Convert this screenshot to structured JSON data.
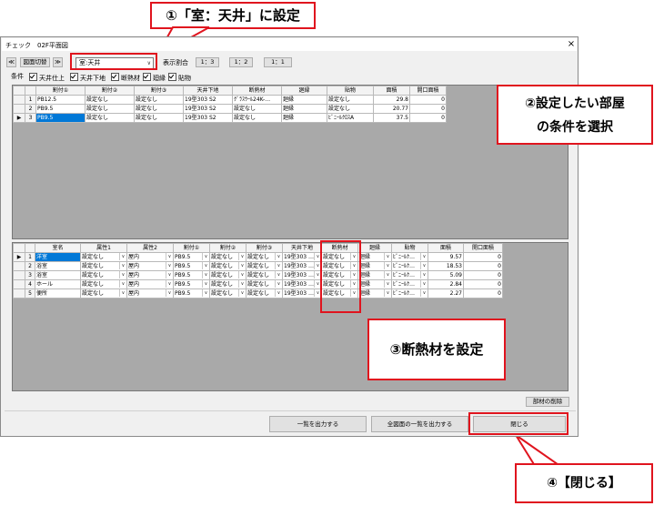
{
  "callouts": {
    "c1": "①「室：天井」に設定",
    "c2_line1": "②設定したい部屋",
    "c2_line2": "の条件を選択",
    "c3": "③断熱材を設定",
    "c4": "④【閉じる】"
  },
  "window": {
    "title": "チェック　02F平面図",
    "close": "×"
  },
  "toolbar": {
    "prev": "≪",
    "switch_label": "図面切替",
    "next": "≫",
    "combo_value": "室:天井",
    "ratio_label": "表示割合",
    "ratios": [
      "1：3",
      "1：2",
      "1：1"
    ]
  },
  "conditions": {
    "label": "条件",
    "items": [
      "天井仕上",
      "天井下地",
      "断熱材",
      "廻縁",
      "貼物"
    ]
  },
  "top_grid": {
    "headers": [
      "",
      "",
      "割付①",
      "割付②",
      "割付③",
      "天井下地",
      "断熱材",
      "廻縁",
      "貼物",
      "面積",
      "開口面積"
    ],
    "rows": [
      {
        "marker": "",
        "no": "1",
        "c1": "PB12.5",
        "c2": "設定なし",
        "c3": "設定なし",
        "c4": "19型303 S2",
        "c5": "ｸﾞﾗｽｳｰﾙ24K-…",
        "c6": "廻縁",
        "c7": "設定なし",
        "area": "29.8",
        "open": "0"
      },
      {
        "marker": "",
        "no": "2",
        "c1": "PB9.5",
        "c2": "設定なし",
        "c3": "設定なし",
        "c4": "19型303 S2",
        "c5": "設定なし",
        "c6": "廻縁",
        "c7": "設定なし",
        "area": "20.77",
        "open": "0"
      },
      {
        "marker": "▶",
        "no": "3",
        "c1": "PB9.5",
        "c2": "設定なし",
        "c3": "設定なし",
        "c4": "19型303 S2",
        "c5": "設定なし",
        "c6": "廻縁",
        "c7": "ﾋﾞﾆｰﾙｸﾛｽA",
        "area": "37.5",
        "open": "0"
      }
    ]
  },
  "bottom_grid": {
    "headers": [
      "",
      "",
      "室名",
      "属性1",
      "属性2",
      "割付①",
      "割付②",
      "割付③",
      "天井下地",
      "断熱材",
      "廻縁",
      "貼物",
      "面積",
      "開口面積"
    ],
    "rows": [
      {
        "marker": "▶",
        "no": "1",
        "name": "洋室",
        "a1": "設定なし",
        "a2": "屋内",
        "k1": "PB9.5",
        "k2": "設定なし",
        "k3": "設定なし",
        "base": "19型303 …",
        "ins": "設定なし",
        "mawa": "廻縁",
        "hari": "ﾋﾞﾆｰﾙｸ…",
        "area": "9.57",
        "open": "0"
      },
      {
        "marker": "",
        "no": "2",
        "name": "浴室",
        "a1": "設定なし",
        "a2": "屋内",
        "k1": "PB9.5",
        "k2": "設定なし",
        "k3": "設定なし",
        "base": "19型303 …",
        "ins": "設定なし",
        "mawa": "廻縁",
        "hari": "ﾋﾞﾆｰﾙｸ…",
        "area": "18.53",
        "open": "0"
      },
      {
        "marker": "",
        "no": "3",
        "name": "浴室",
        "a1": "設定なし",
        "a2": "屋内",
        "k1": "PB9.5",
        "k2": "設定なし",
        "k3": "設定なし",
        "base": "19型303 …",
        "ins": "設定なし",
        "mawa": "廻縁",
        "hari": "ﾋﾞﾆｰﾙｸ…",
        "area": "5.09",
        "open": "0"
      },
      {
        "marker": "",
        "no": "4",
        "name": "ホール",
        "a1": "設定なし",
        "a2": "屋内",
        "k1": "PB9.5",
        "k2": "設定なし",
        "k3": "設定なし",
        "base": "19型303 …",
        "ins": "設定なし",
        "mawa": "廻縁",
        "hari": "ﾋﾞﾆｰﾙｸ…",
        "area": "2.84",
        "open": "0"
      },
      {
        "marker": "",
        "no": "5",
        "name": "便所",
        "a1": "設定なし",
        "a2": "屋内",
        "k1": "PB9.5",
        "k2": "設定なし",
        "k3": "設定なし",
        "base": "19型303 …",
        "ins": "設定なし",
        "mawa": "廻縁",
        "hari": "ﾋﾞﾆｰﾙｸ…",
        "area": "2.27",
        "open": "0"
      }
    ]
  },
  "footer": {
    "delete_label": "部材の削除",
    "export_one": "一覧を出力する",
    "export_all": "全図面の一覧を出力する",
    "close": "閉じる"
  },
  "colors": {
    "callout_red": "#e0141e",
    "selection_blue": "#0078d7",
    "grid_background": "#a9a9a9"
  }
}
